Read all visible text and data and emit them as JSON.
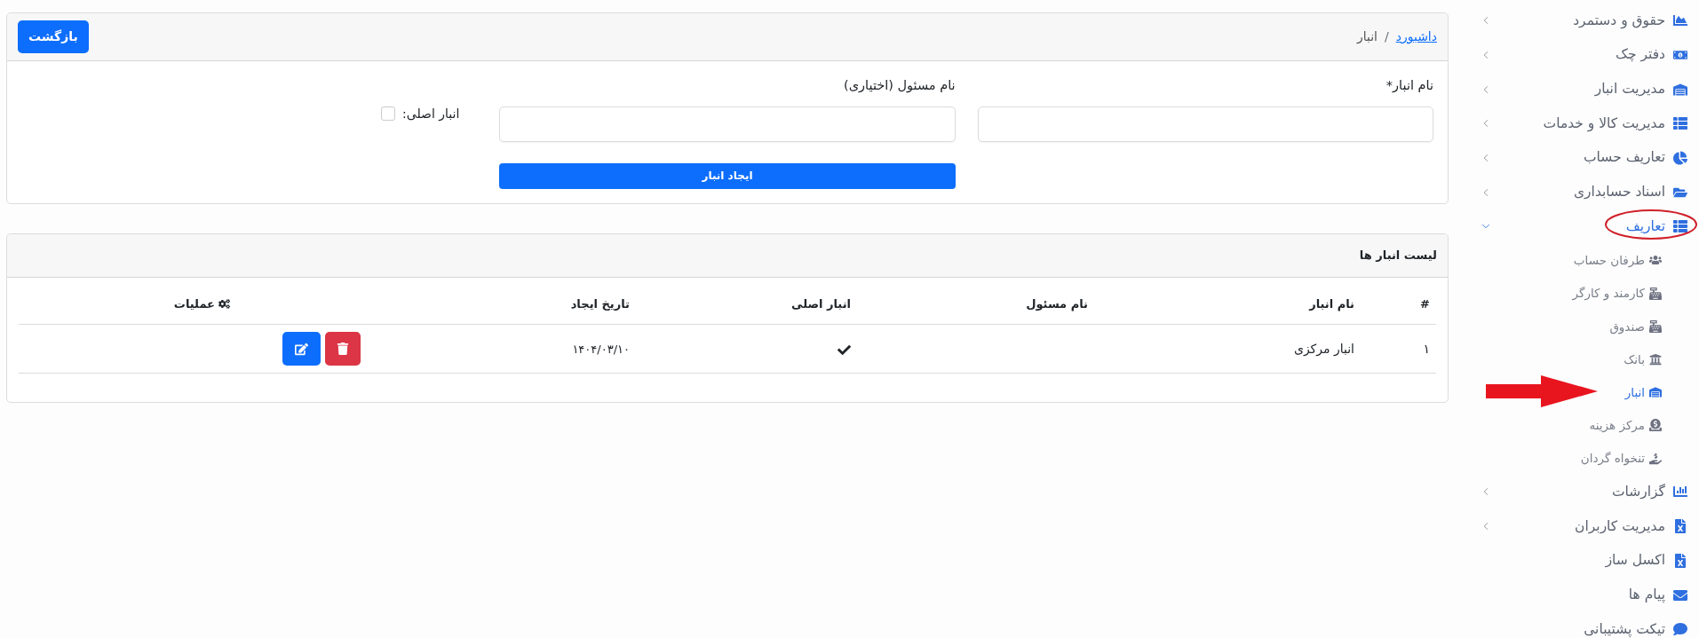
{
  "sidebar": {
    "items": [
      {
        "label": "حقوق و دستمرد",
        "kind": "group",
        "expanded": false,
        "selected": false
      },
      {
        "label": "دفتر چک",
        "kind": "group",
        "expanded": false,
        "selected": false
      },
      {
        "label": "مدیریت انبار",
        "kind": "group",
        "expanded": false,
        "selected": false
      },
      {
        "label": "مدیریت کالا و خدمات",
        "kind": "group",
        "expanded": false,
        "selected": false
      },
      {
        "label": "تعاریف حساب",
        "kind": "group",
        "expanded": false,
        "selected": false
      },
      {
        "label": "اسناد حسابداری",
        "kind": "group",
        "expanded": false,
        "selected": false
      },
      {
        "label": "تعاریف",
        "kind": "group",
        "expanded": true,
        "selected": true,
        "children": [
          {
            "label": "طرفان حساب",
            "selected": false
          },
          {
            "label": "کارمند و کارگر",
            "selected": false
          },
          {
            "label": "صندوق",
            "selected": false
          },
          {
            "label": "بانک",
            "selected": false
          },
          {
            "label": "انبار",
            "selected": true
          },
          {
            "label": "مرکز هزینه",
            "selected": false
          },
          {
            "label": "تنخواه گردان",
            "selected": false
          }
        ]
      },
      {
        "label": "گزارشات",
        "kind": "group",
        "expanded": false,
        "selected": false
      },
      {
        "label": "مدیریت کاربران",
        "kind": "group",
        "expanded": false,
        "selected": false
      },
      {
        "label": "اکسل ساز",
        "kind": "link",
        "selected": false
      },
      {
        "label": "پیام ها",
        "kind": "link",
        "selected": false
      },
      {
        "label": "تیکت پشتیبانی",
        "kind": "link",
        "selected": false
      }
    ]
  },
  "breadcrumb": {
    "separator": "/",
    "items": [
      {
        "label": "داشبورد",
        "kind": "link"
      },
      {
        "label": "انبار",
        "kind": "current"
      }
    ]
  },
  "back_button": "بازگشت",
  "form": {
    "fields": [
      {
        "label": "نام انبار*"
      },
      {
        "label": "نام مسئول (اختیاری)"
      }
    ],
    "checkbox": {
      "label": "انبار اصلی:",
      "checked": false
    },
    "submit": "ایجاد انبار"
  },
  "list": {
    "title": "لیست انبار ها",
    "columns": [
      "#",
      "نام انبار",
      "نام مسئول",
      "انبار اصلی",
      "تاریخ ایجاد",
      "عملیات"
    ],
    "rows": [
      {
        "index": "۱",
        "name": "انبار مرکزی",
        "main": true,
        "created": "۱۴۰۴/۰۳/۱۰"
      }
    ]
  }
}
